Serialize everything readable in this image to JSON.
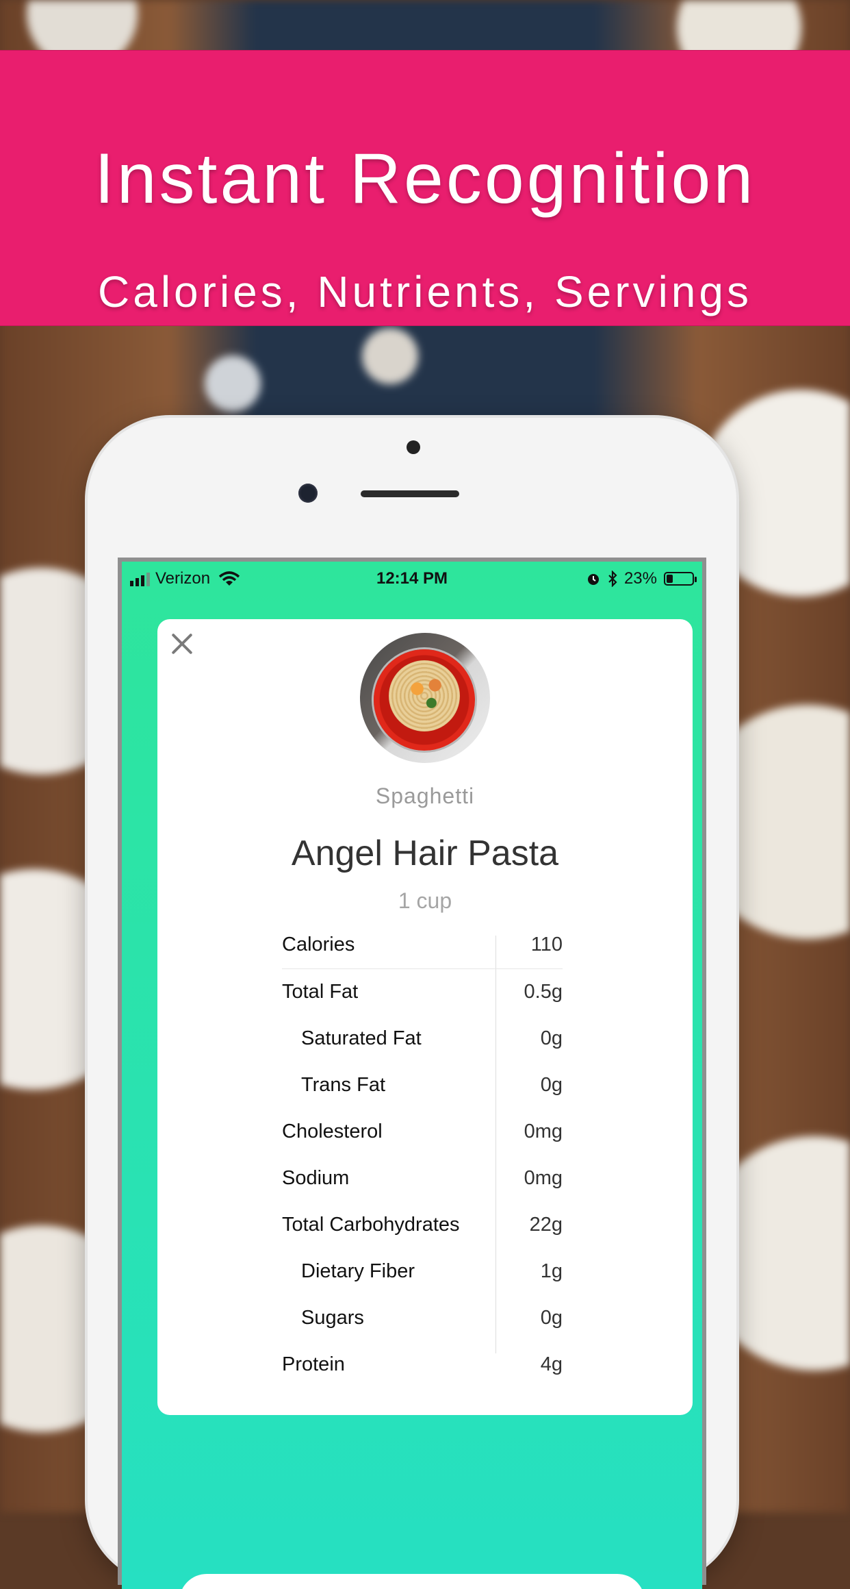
{
  "banner": {
    "title": "Instant Recognition",
    "subtitle": "Calories, Nutrients, Servings"
  },
  "status_bar": {
    "carrier": "Verizon",
    "time": "12:14 PM",
    "battery": "23%",
    "battery_level": 0.23
  },
  "food": {
    "category": "Spaghetti",
    "name": "Angel Hair Pasta",
    "serving": "1 cup"
  },
  "nutrition": [
    {
      "label": "Calories",
      "value": "110",
      "sub": false
    },
    {
      "label": "Total Fat",
      "value": "0.5g",
      "sub": false
    },
    {
      "label": "Saturated Fat",
      "value": "0g",
      "sub": true
    },
    {
      "label": "Trans Fat",
      "value": "0g",
      "sub": true
    },
    {
      "label": "Cholesterol",
      "value": "0mg",
      "sub": false
    },
    {
      "label": "Sodium",
      "value": "0mg",
      "sub": false
    },
    {
      "label": "Total Carbohydrates",
      "value": "22g",
      "sub": false
    },
    {
      "label": "Dietary Fiber",
      "value": "1g",
      "sub": true
    },
    {
      "label": "Sugars",
      "value": "0g",
      "sub": true
    },
    {
      "label": "Protein",
      "value": "4g",
      "sub": false
    }
  ],
  "colors": {
    "banner": "#e91e6e",
    "screen_top": "#2ee59c",
    "screen_bottom": "#26e0c2"
  }
}
